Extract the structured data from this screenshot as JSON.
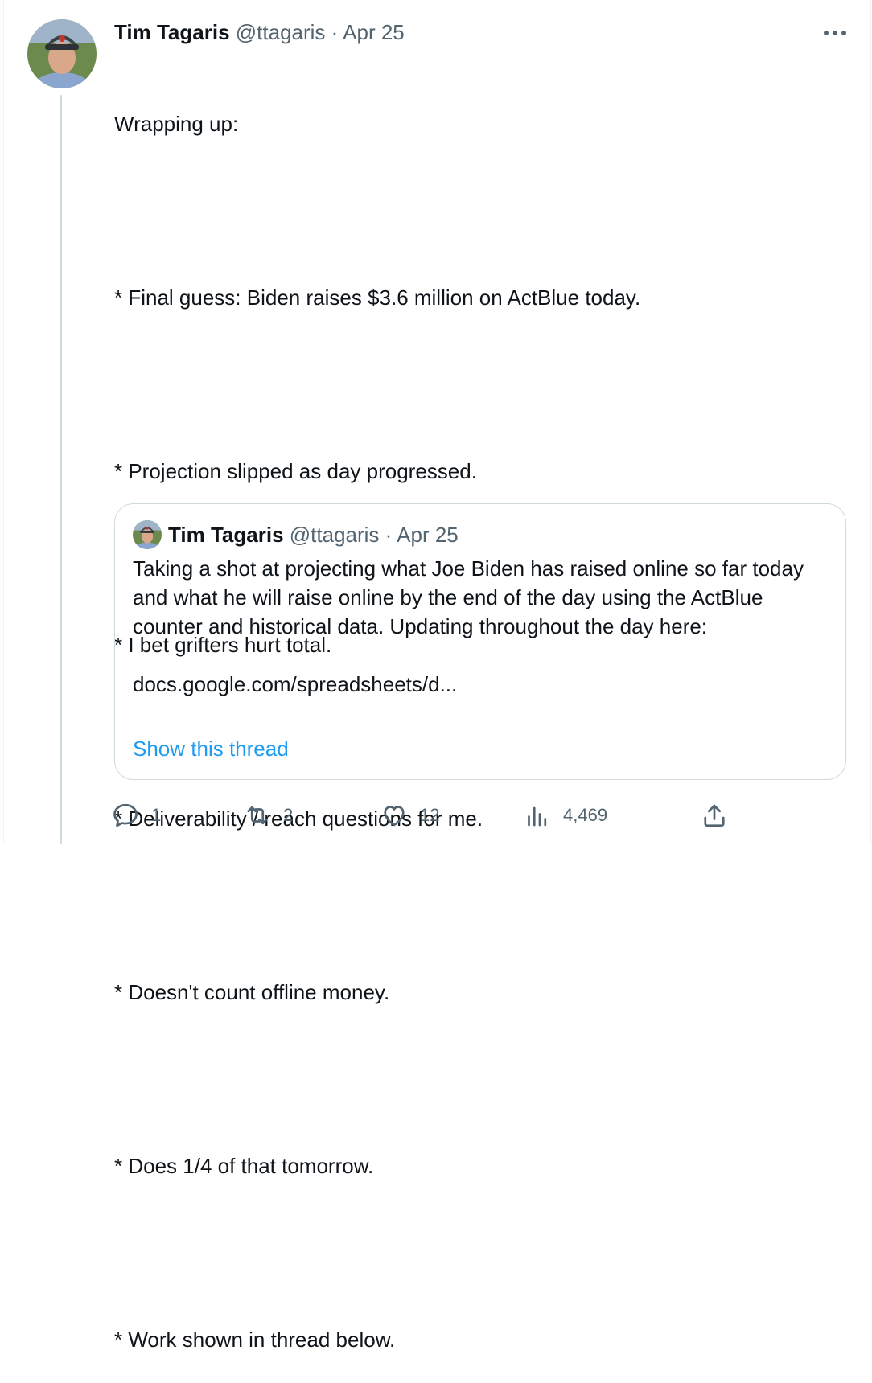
{
  "tweet": {
    "author_name": "Tim Tagaris",
    "handle": "@ttagaris",
    "separator": "·",
    "date": "Apr 25",
    "more_label": "···",
    "lines": [
      "Wrapping up:",
      "",
      "* Final guess: Biden raises $3.6 million on ActBlue today.",
      "",
      "* Projection slipped as day progressed.",
      "",
      "* I bet grifters hurt total.",
      "",
      "* Deliverability / reach questions for me.",
      "",
      "* Doesn't count offline money.",
      "",
      "* Does 1/4 of that tomorrow.",
      "",
      "* Work shown in thread below."
    ]
  },
  "quoted": {
    "author_name": "Tim Tagaris",
    "handle": "@ttagaris",
    "separator": "·",
    "date": "Apr 25",
    "text": "Taking a shot at projecting what Joe Biden has raised online so far today and what he will raise online by the end of the day using the ActBlue counter and historical data. Updating throughout the day here:\n\ndocs.google.com/spreadsheets/d...",
    "show_thread": "Show this thread"
  },
  "actions": {
    "replies": "1",
    "retweets": "2",
    "likes": "12",
    "views": "4,469"
  },
  "icons": {
    "reply": "reply-icon",
    "retweet": "retweet-icon",
    "like": "heart-icon",
    "views": "views-icon",
    "share": "share-icon",
    "more": "more-icon"
  },
  "colors": {
    "text": "#0f1419",
    "muted": "#536471",
    "link": "#1d9bf0",
    "border": "#cfd9de"
  }
}
